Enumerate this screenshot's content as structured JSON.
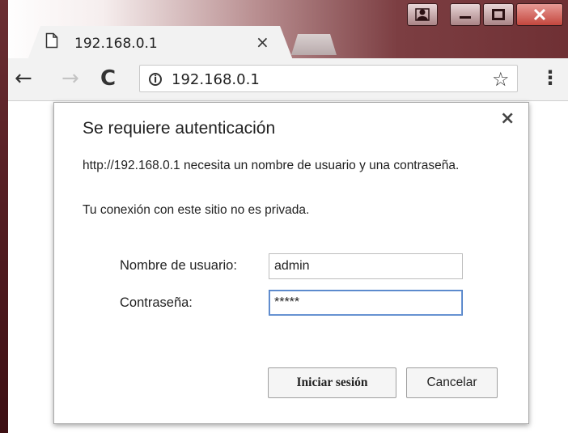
{
  "browser": {
    "tab": {
      "title": "192.168.0.1",
      "close_glyph": "×",
      "icon": "page-icon"
    },
    "new_tab_icon": "new-tab-icon",
    "window_controls": {
      "user": "user-icon",
      "minimize": "minimize-icon",
      "maximize": "maximize-icon",
      "close": "close-icon"
    },
    "toolbar": {
      "back_glyph": "←",
      "forward_glyph": "→",
      "reload_glyph": "C",
      "info_glyph": "i",
      "url": "192.168.0.1",
      "star_glyph": "☆",
      "menu_glyph": "⋮"
    }
  },
  "dialog": {
    "close_glyph": "×",
    "title": "Se requiere autenticación",
    "message": "http://192.168.0.1 necesita un nombre de usuario y una contraseña.",
    "privacy_note": "Tu conexión con este sitio no es privada.",
    "username_label": "Nombre de usuario:",
    "username_value": "admin",
    "password_label": "Contraseña:",
    "password_value": "*****",
    "login_button": "Iniciar sesión",
    "cancel_button": "Cancelar"
  }
}
